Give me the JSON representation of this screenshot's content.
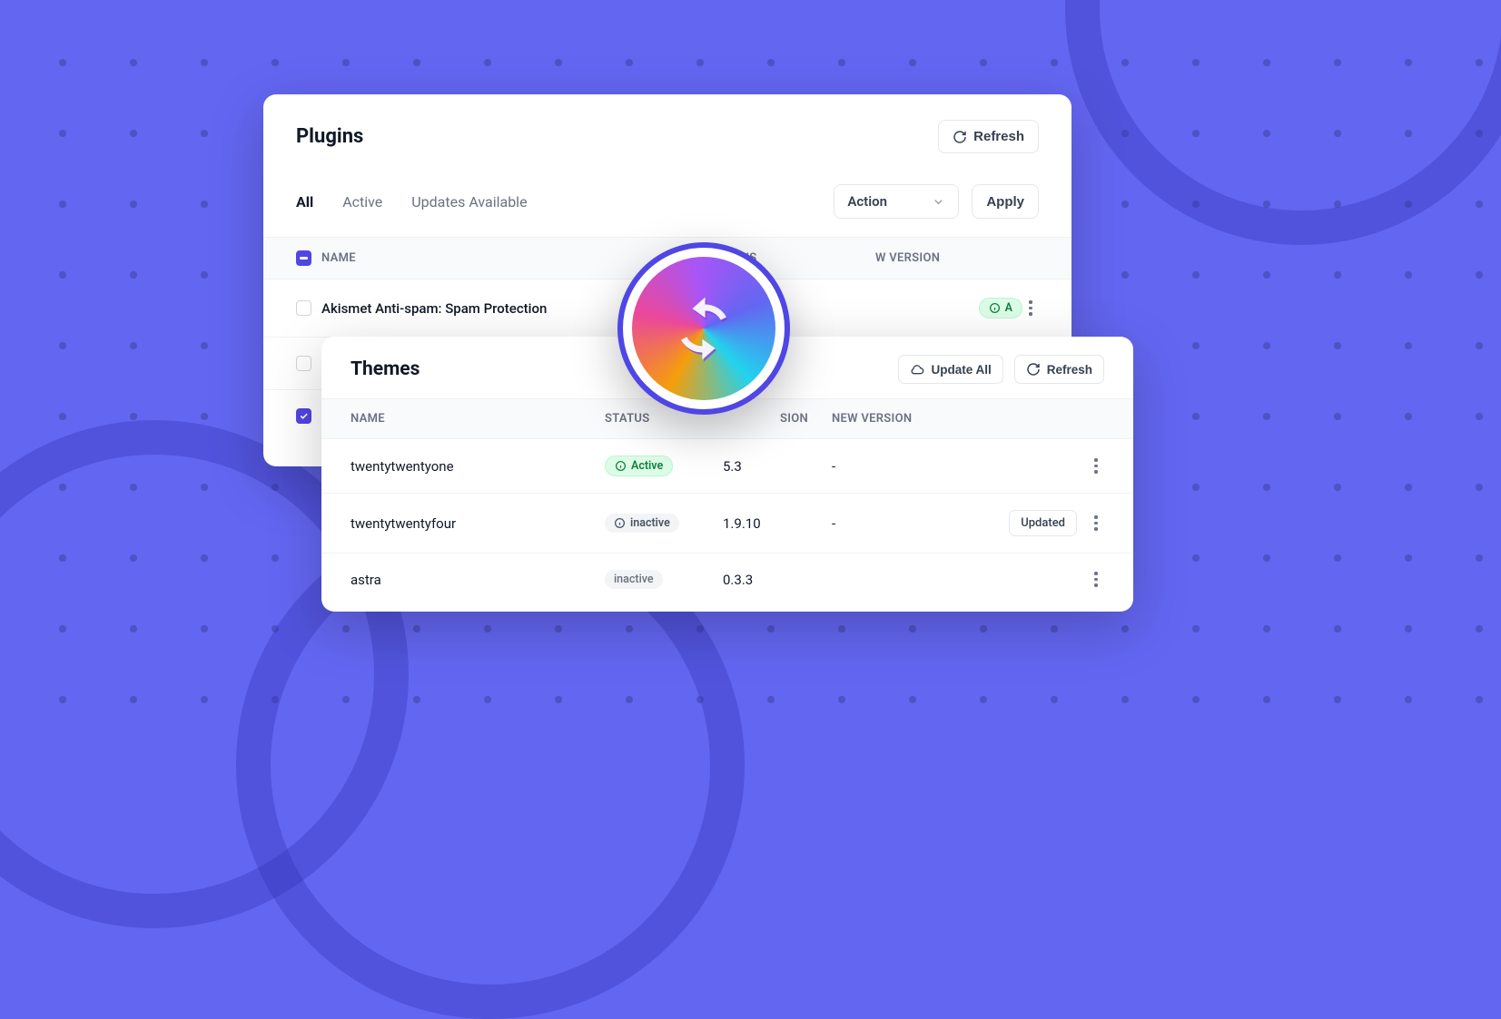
{
  "plugins": {
    "title": "Plugins",
    "refresh_label": "Refresh",
    "tabs": {
      "all": "All",
      "active": "Active",
      "updates": "Updates Available"
    },
    "action_select": "Action",
    "apply_label": "Apply",
    "columns": {
      "name": "NAME",
      "status": "STATUS",
      "new_version": "W VERSION"
    },
    "rows": [
      {
        "name": "Akismet Anti-spam: Spam Protection",
        "status_prefix": "A"
      }
    ]
  },
  "themes": {
    "title": "Themes",
    "update_all_label": "Update All",
    "refresh_label": "Refresh",
    "columns": {
      "name": "NAME",
      "status": "STATUS",
      "version": "SION",
      "new_version": "NEW VERSION"
    },
    "rows": [
      {
        "name": "twentytwentyone",
        "status": "Active",
        "status_kind": "active",
        "version": "5.3",
        "new_version": "-",
        "action": ""
      },
      {
        "name": "twentytwentyfour",
        "status": "inactive",
        "status_kind": "inactive",
        "version": "1.9.10",
        "new_version": "-",
        "action": "Updated"
      },
      {
        "name": "astra",
        "status": "inactive",
        "status_kind": "plain",
        "version": "0.3.3",
        "new_version": "",
        "action": ""
      }
    ]
  }
}
